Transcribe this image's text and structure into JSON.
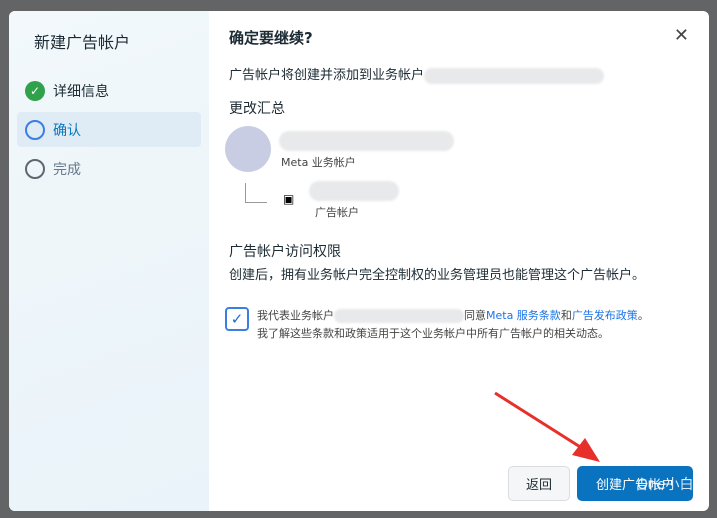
{
  "sidebar": {
    "title": "新建广告帐户",
    "steps": [
      {
        "label": "详细信息",
        "state": "done"
      },
      {
        "label": "确认",
        "state": "current"
      },
      {
        "label": "完成",
        "state": "pending"
      }
    ]
  },
  "main": {
    "title": "确定要继续?",
    "intro": "广告帐户将创建并添加到业务帐户",
    "summary_heading": "更改汇总",
    "business_type": "Meta 业务帐户",
    "ad_account_type": "广告帐户",
    "access_heading": "广告帐户访问权限",
    "access_text": "创建后，拥有业务帐户完全控制权的业务管理员也能管理这个广告帐户。",
    "consent": {
      "prefix": "我代表业务帐户",
      "agree": "同意",
      "terms_link": "Meta 服务条款",
      "and": "和",
      "policy_link": "广告发布政策",
      "end": "。",
      "line2": "我了解这些条款和政策适用于这个业务帐户中所有广告帐户的相关动态。",
      "checked": true
    }
  },
  "footer": {
    "back_label": "返回",
    "create_label": "创建广告帐户"
  },
  "watermark": "One小白",
  "colors": {
    "accent": "#0a73c0",
    "success": "#31a24c",
    "arrow": "#e8302a"
  }
}
